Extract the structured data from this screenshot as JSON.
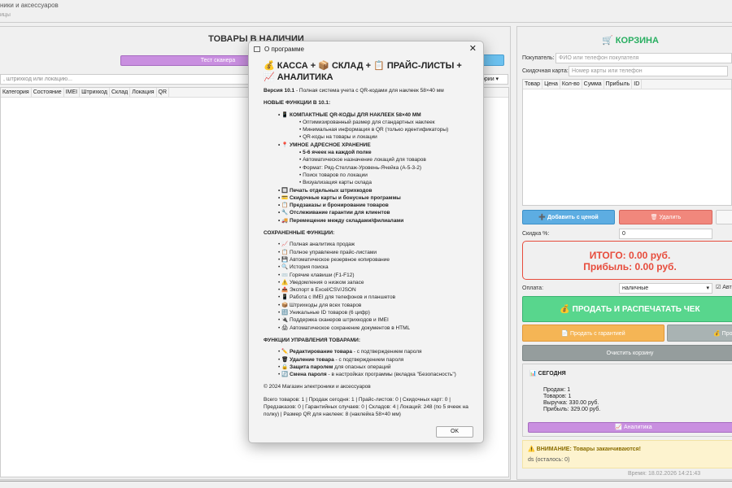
{
  "window": {
    "subtitle": "ники и аксессуаров",
    "subtitle2": "ицы"
  },
  "left": {
    "title": "ТОВАРЫ В НАЛИЧИИ",
    "scan_button": "Тест сканера",
    "search_placeholder": ", штрихкод или локацию...",
    "category_select": "ории",
    "columns": [
      "Категория",
      "Состояние",
      "IMEI",
      "Штрихкод",
      "Склад",
      "Локация",
      "QR"
    ]
  },
  "cart": {
    "title": "🛒 КОРЗИНА",
    "buyer_label": "Покупатель:",
    "buyer_placeholder": "ФИО или телефон покупателя",
    "card_label": "Скидочная карта:",
    "card_placeholder": "Номер карты или телефон",
    "columns": [
      "Товар",
      "Цена",
      "Кол-во",
      "Сумма",
      "Прибыль",
      "ID"
    ],
    "add_button": "➕ Добавить с ценой",
    "delete_button": "🗑 Удалить",
    "discount_label": "Скидка %:",
    "discount_value": "0",
    "total": "ИТОГО: 0.00 руб.",
    "profit": "Прибыль: 0.00 руб.",
    "payment_label": "Оплата:",
    "payment_value": "наличные",
    "auto_label": "Авт",
    "sell_button": "💰 ПРОДАТЬ И РАСПЕЧАТАТЬ ЧЕК",
    "warranty_button": "📄 Продать с гарантией",
    "other_button": "💰 Прода",
    "clear_button": "Очистить корзину"
  },
  "today": {
    "title": "📊 СЕГОДНЯ",
    "lines": [
      "Продаж: 1",
      "Товаров: 1",
      "Выручка: 330.00 руб.",
      "Прибыль: 329.00 руб."
    ],
    "analytics_button": "📈 Аналитика"
  },
  "warning": {
    "title": "⚠️ ВНИМАНИЕ: Товары заканчиваются!",
    "item": "ds (осталось: 0)"
  },
  "status": {
    "time": "Время: 18.02.2026 14:21:43"
  },
  "dialog": {
    "title": "О программе",
    "heading": "💰 КАССА + 📦 СКЛАД + 📋 ПРАЙС-ЛИСТЫ + 📈 АНАЛИТИКА",
    "version_bold": "Версия 10.1",
    "version_rest": " - Полная система учета с QR-кодами для наклеек 58×40 мм",
    "new_title": "НОВЫЕ ФУНКЦИИ В 10.1:",
    "new_items": [
      {
        "t": "📱 КОМПАКТНЫЕ QR-КОДЫ ДЛЯ НАКЛЕЕК 58×40 ММ",
        "b": true,
        "l": 1
      },
      {
        "t": "Оптимизированный размер для стандартных наклеек",
        "b": false,
        "l": 2
      },
      {
        "t": "Минимальная информация в QR (только идентификаторы)",
        "b": false,
        "l": 2
      },
      {
        "t": "QR-коды на товары и локации",
        "b": false,
        "l": 2
      },
      {
        "t": "📍 УМНОЕ АДРЕСНОЕ ХРАНЕНИЕ",
        "b": true,
        "l": 1
      },
      {
        "t": "5-6 ячеек на каждой полке",
        "b": true,
        "l": 2
      },
      {
        "t": "Автоматическое назначение локаций для товаров",
        "b": false,
        "l": 2
      },
      {
        "t": "Формат: Ряд-Стеллаж-Уровень-Ячейка (A-5-3-2)",
        "b": false,
        "l": 2
      },
      {
        "t": "Поиск товаров по локации",
        "b": false,
        "l": 2
      },
      {
        "t": "Визуализация карты склада",
        "b": false,
        "l": 2
      },
      {
        "t": "🔲 Печать отдельных штрихкодов",
        "b": true,
        "l": 1
      },
      {
        "t": "💳 Скидочные карты и бонусные программы",
        "b": true,
        "l": 1
      },
      {
        "t": "📋 Предзаказы и бронирование товаров",
        "b": true,
        "l": 1
      },
      {
        "t": "🔧 Отслеживание гарантии для клиентов",
        "b": true,
        "l": 1
      },
      {
        "t": "🚚 Перемещение между складами/филиалами",
        "b": true,
        "l": 1
      }
    ],
    "saved_title": "СОХРАНЕННЫЕ ФУНКЦИИ:",
    "saved_items": [
      "📈 Полная аналитика продаж",
      "📋 Полное управление прайс-листами",
      "💾 Автоматическое резервное копирование",
      "🔍 История поиска",
      "⌨️ Горячие клавиши (F1-F12)",
      "⚠️ Уведомления о низком запасе",
      "📤 Экспорт в Excel/CSV/JSON",
      "📱 Работа с IMEI для телефонов и планшетов",
      "📦 Штрихкоды для всех товаров",
      "🔢 Уникальные ID товаров (6 цифр)",
      "🔌 Поддержка сканеров штрихкодов и IMEI",
      "🖨 Автоматическое сохранение документов в HTML"
    ],
    "manage_title": "ФУНКЦИИ УПРАВЛЕНИЯ ТОВАРАМИ:",
    "manage_items": [
      {
        "b": "✏️ Редактирование товара",
        "r": " - с подтверждением пароля"
      },
      {
        "b": "🗑 Удаление товара",
        "r": " - с подтверждением пароля"
      },
      {
        "b": "🔒 Защита паролем",
        "r": " для опасных операций"
      },
      {
        "b": "🔄 Смена пароля",
        "r": " - в настройках программы (вкладка \"Безопасность\")"
      }
    ],
    "copyright": "© 2024 Магазин электроники и аксессуаров",
    "stats": "Всего товаров: 1 | Продаж сегодня: 1 | Прайс-листов: 0 | Скидочных карт: 0 | Предзаказов: 0 | Гарантийных случаев: 0 | Складов: 4 | Локаций: 248 (по 5 ячеек на полку) | Размер QR для наклеек: 8 (наклейка 58×40 мм)",
    "ok": "OK"
  }
}
